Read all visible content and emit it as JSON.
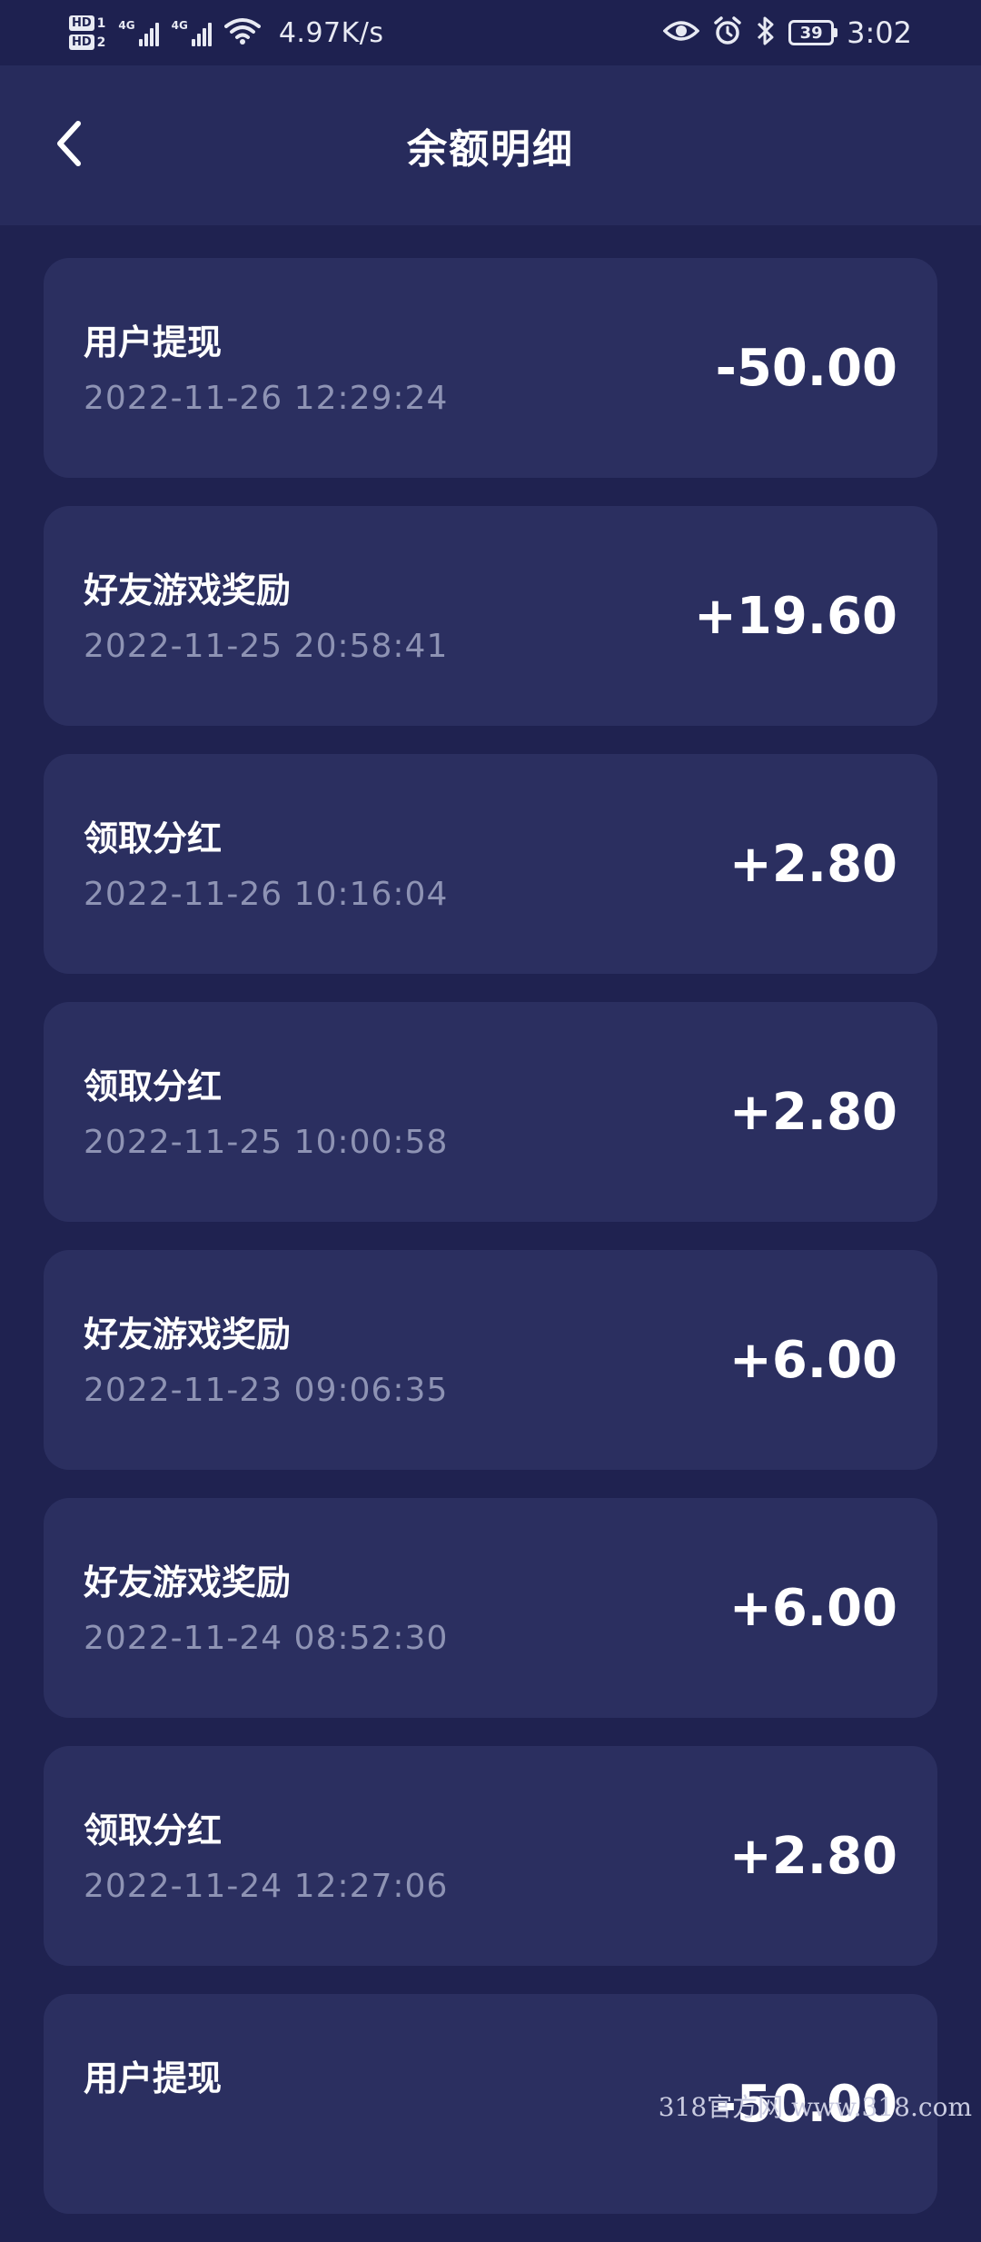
{
  "status_bar": {
    "hd1": "HD",
    "hd1_num": "1",
    "hd2": "HD",
    "hd2_num": "2",
    "net1": "4G",
    "net2": "4G",
    "net_speed": "4.97K/s",
    "battery": "39",
    "time": "3:02",
    "icons": [
      "signal-icon",
      "wifi-icon",
      "eye-icon",
      "alarm-icon",
      "bluetooth-icon",
      "battery-icon"
    ]
  },
  "header": {
    "title": "余额明细",
    "back_icon": "chevron-left-icon"
  },
  "records": [
    {
      "type": "用户提现",
      "time": "2022-11-26 12:29:24",
      "amount": "-50.00"
    },
    {
      "type": "好友游戏奖励",
      "time": "2022-11-25 20:58:41",
      "amount": "+19.60"
    },
    {
      "type": "领取分红",
      "time": "2022-11-26 10:16:04",
      "amount": "+2.80"
    },
    {
      "type": "领取分红",
      "time": "2022-11-25 10:00:58",
      "amount": "+2.80"
    },
    {
      "type": "好友游戏奖励",
      "time": "2022-11-23 09:06:35",
      "amount": "+6.00"
    },
    {
      "type": "好友游戏奖励",
      "time": "2022-11-24 08:52:30",
      "amount": "+6.00"
    },
    {
      "type": "领取分红",
      "time": "2022-11-24 12:27:06",
      "amount": "+2.80"
    },
    {
      "type": "用户提现",
      "time": "",
      "amount": "-50.00"
    }
  ],
  "watermark": "318官方网 www.318.com",
  "colors": {
    "background": "#1f2250",
    "header": "#272b5c",
    "card": "#2b2f60",
    "secondary_text": "#8e93b4"
  }
}
